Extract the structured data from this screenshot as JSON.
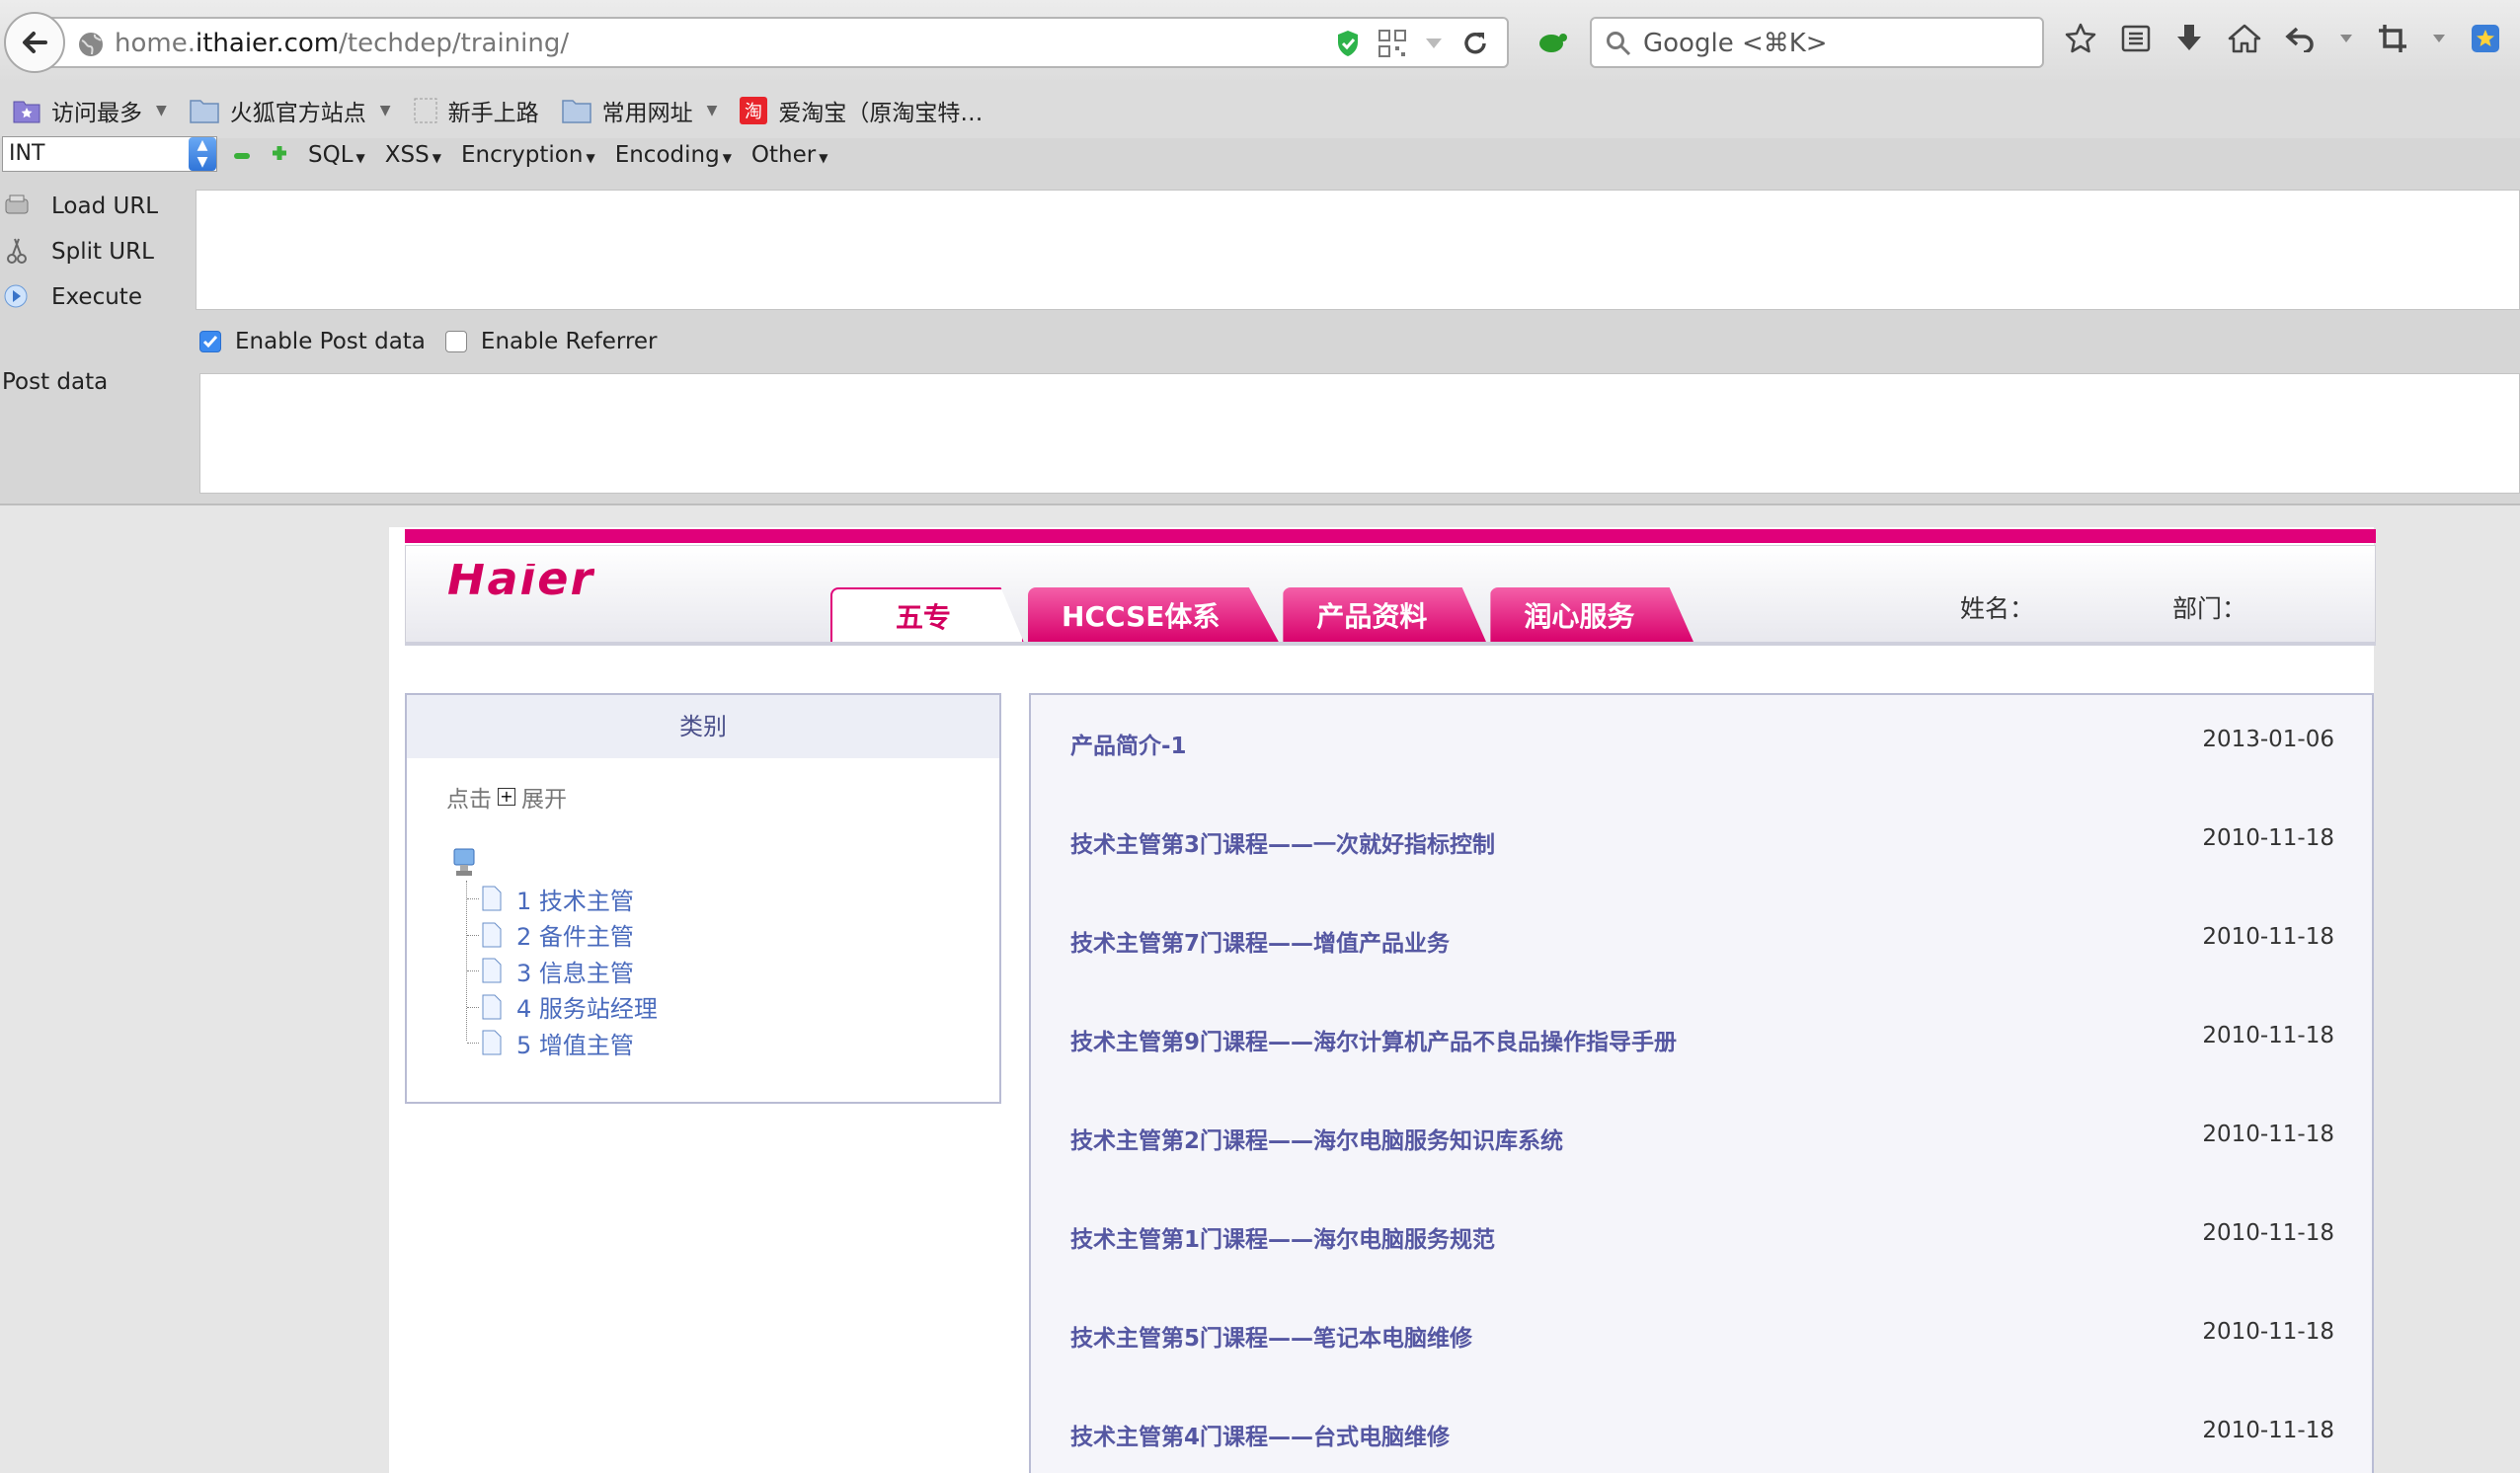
{
  "browser": {
    "url_prefix": "home.",
    "url_domain": "ithaier.com",
    "url_path": "/techdep/training/",
    "search_placeholder": "Google <⌘K>"
  },
  "bookmarks": [
    {
      "label": "访问最多",
      "icon": "most-visited-icon",
      "dropdown": true
    },
    {
      "label": "火狐官方站点",
      "icon": "folder-icon",
      "dropdown": true
    },
    {
      "label": "新手上路",
      "icon": "page-icon",
      "dropdown": false
    },
    {
      "label": "常用网址",
      "icon": "folder-icon",
      "dropdown": true
    },
    {
      "label": "爱淘宝（原淘宝特…",
      "icon": "taobao-icon",
      "dropdown": false
    }
  ],
  "hackbar": {
    "select_value": "INT",
    "menus": [
      "SQL",
      "XSS",
      "Encryption",
      "Encoding",
      "Other"
    ],
    "actions": [
      "Load URL",
      "Split URL",
      "Execute"
    ],
    "enable_post": "Enable Post data",
    "enable_referrer": "Enable Referrer",
    "post_label": "Post data",
    "url_value": "",
    "post_value": ""
  },
  "site": {
    "logo": "Haier",
    "tabs": [
      "五专",
      "HCCSE体系",
      "产品资料",
      "润心服务"
    ],
    "active_tab": 0,
    "name_label": "姓名：",
    "dept_label": "部门：",
    "category": {
      "title": "类别",
      "hint_click": "点击",
      "hint_expand": "展开",
      "items": [
        "1 技术主管",
        "2 备件主管",
        "3 信息主管",
        "4 服务站经理",
        "5 增值主管"
      ]
    },
    "courses": [
      {
        "title": "产品简介-1",
        "date": "2013-01-06"
      },
      {
        "title": "技术主管第3门课程——一次就好指标控制",
        "date": "2010-11-18"
      },
      {
        "title": "技术主管第7门课程——增值产品业务",
        "date": "2010-11-18"
      },
      {
        "title": "技术主管第9门课程——海尔计算机产品不良品操作指导手册",
        "date": "2010-11-18"
      },
      {
        "title": "技术主管第2门课程——海尔电脑服务知识库系统",
        "date": "2010-11-18"
      },
      {
        "title": "技术主管第1门课程——海尔电脑服务规范",
        "date": "2010-11-18"
      },
      {
        "title": "技术主管第5门课程——笔记本电脑维修",
        "date": "2010-11-18"
      },
      {
        "title": "技术主管第4门课程——台式电脑维修",
        "date": "2010-11-18"
      }
    ]
  },
  "colors": {
    "brand": "#e0007a",
    "link": "#5557a2"
  }
}
